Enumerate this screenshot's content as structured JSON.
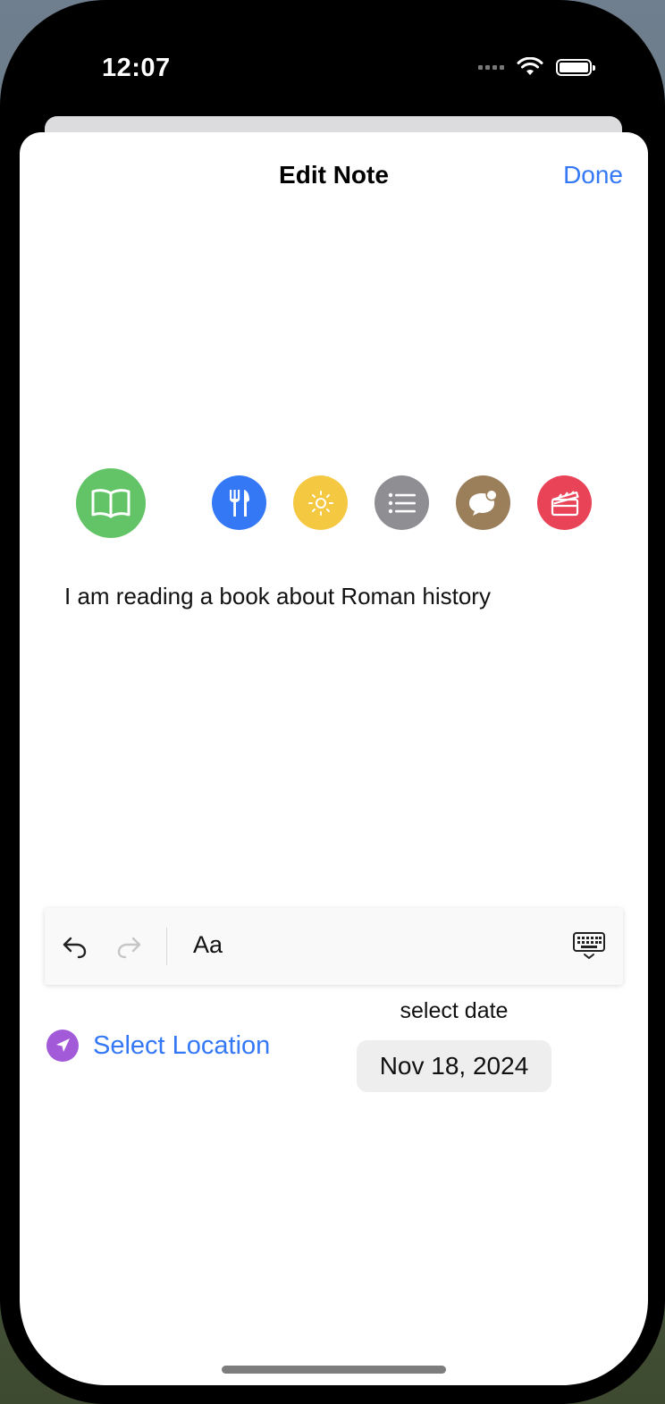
{
  "status_bar": {
    "time": "12:07"
  },
  "nav": {
    "title": "Edit Note",
    "done_label": "Done"
  },
  "categories": [
    {
      "name": "book",
      "color": "#62c466",
      "selected": true
    },
    {
      "name": "fork-knife",
      "color": "#3478f6",
      "selected": false
    },
    {
      "name": "sun",
      "color": "#f5c842",
      "selected": false
    },
    {
      "name": "list",
      "color": "#8e8e93",
      "selected": false
    },
    {
      "name": "speech-bubble",
      "color": "#9b7e5a",
      "selected": false
    },
    {
      "name": "clapperboard",
      "color": "#e94358",
      "selected": false
    }
  ],
  "note": {
    "text": "I am reading a book about Roman history"
  },
  "toolbar": {
    "format_label": "Aa"
  },
  "location": {
    "label": "Select Location",
    "icon_color": "#a25ad9"
  },
  "date": {
    "caption": "select date",
    "value": "Nov 18, 2024"
  }
}
